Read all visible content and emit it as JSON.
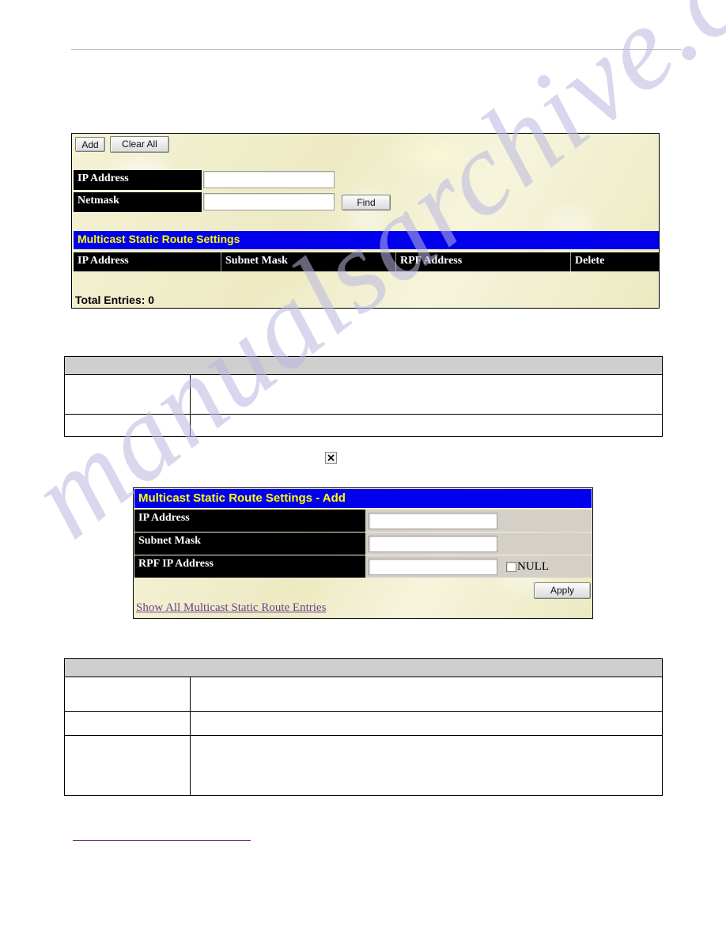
{
  "document": {
    "has_header_rule": true,
    "watermark_text": "manualsarchive.com"
  },
  "search_panel": {
    "buttons": {
      "add": "Add",
      "clear_all": "Clear All",
      "find": "Find"
    },
    "fields": [
      {
        "label": "IP Address",
        "value": "",
        "placeholder": ""
      },
      {
        "label": "Netmask",
        "value": "",
        "placeholder": ""
      }
    ],
    "section_title": "Multicast Static Route Settings",
    "table": {
      "columns": [
        "IP Address",
        "Subnet Mask",
        "RPF Address",
        "Delete"
      ],
      "rows": []
    },
    "total_entries": "Total Entries: 0"
  },
  "desc_table_1": {
    "header": "",
    "rows": [
      {
        "parameter": "",
        "description": ""
      },
      {
        "parameter": "",
        "description": ""
      }
    ]
  },
  "add_panel": {
    "title": "Multicast Static Route Settings - Add",
    "fields": [
      {
        "label": "IP Address",
        "value": "",
        "extra": ""
      },
      {
        "label": "Subnet Mask",
        "value": "",
        "extra": ""
      },
      {
        "label": "RPF IP Address",
        "value": "",
        "extra": "NULL"
      }
    ],
    "apply_label": "Apply",
    "show_all_link": "Show All Multicast Static Route Entries",
    "null_checked": false
  },
  "desc_table_2": {
    "header": "",
    "rows": [
      {
        "parameter": "",
        "description": ""
      },
      {
        "parameter": "",
        "description": ""
      },
      {
        "parameter": "",
        "description": ""
      }
    ]
  },
  "icons": {
    "broken_image": "broken-image-icon"
  },
  "colors": {
    "panel_background": "#f2f0cf",
    "title_bar": "#0000ee",
    "title_text": "#ffff00",
    "header_cell": "#000000",
    "gray_header": "#cfcfcf",
    "link": "#6a3f8f",
    "bottom_link_underline": "#6a0a6a",
    "watermark": "#b9b7e0",
    "field_backdrop": "#d4d0c8"
  }
}
